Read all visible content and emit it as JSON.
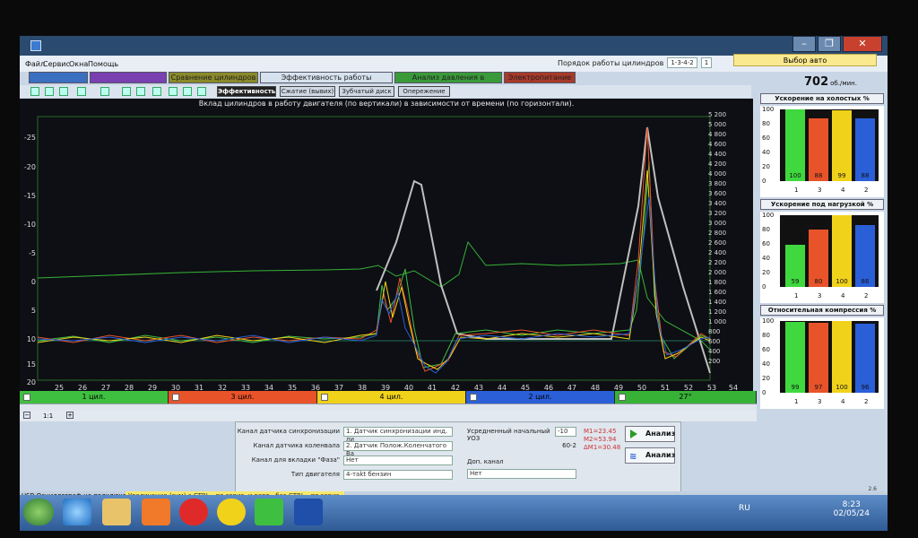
{
  "menu": [
    "Файл",
    "Сервис",
    "Окна",
    "Помощь"
  ],
  "cylinder_order": {
    "label": "Порядок работы цилиндров",
    "value": "1-3-4-2",
    "count": "1"
  },
  "auto_select": "Выбор авто",
  "tabs": [
    {
      "label": "",
      "color": "#3b6fc0"
    },
    {
      "label": "",
      "color": "#7a3fb0"
    },
    {
      "label": "Сравнение цилиндров",
      "color": "#8a8a2a"
    },
    {
      "label": "Эффективность работы цилиндров",
      "color": "#d6e2ee"
    },
    {
      "label": "Анализ давления в цилиндре",
      "color": "#3a9a3a"
    },
    {
      "label": "Электропитание",
      "color": "#a83a2a"
    }
  ],
  "rpm": {
    "value": "702",
    "unit": "об./мин."
  },
  "subtabs": [
    "Эффективность",
    "Сжатие (вывих)",
    "Зубчатый диск",
    "Опережение"
  ],
  "plot_title": "Вклад цилиндров в работу двигателя (по вертикали) в зависимости от времени (по горизонтали).",
  "left_ticks": [
    "-25",
    "-20",
    "-15",
    "-10",
    "-5",
    "0",
    "5",
    "10",
    "15",
    "20"
  ],
  "right_ticks": [
    "5 200",
    "5 000",
    "4 800",
    "4 600",
    "4 400",
    "4 200",
    "4 000",
    "3 800",
    "3 600",
    "3 400",
    "3 200",
    "3 000",
    "2 800",
    "2 600",
    "2 400",
    "2 200",
    "2 000",
    "1 800",
    "1 600",
    "1 400",
    "1 200",
    "1 000",
    "800",
    "600",
    "400",
    "200"
  ],
  "x_ticks": [
    "25",
    "26",
    "27",
    "28",
    "29",
    "30",
    "31",
    "32",
    "33",
    "34",
    "35",
    "36",
    "37",
    "38",
    "39",
    "40",
    "41",
    "42",
    "43",
    "44",
    "45",
    "46",
    "47",
    "48",
    "49",
    "50",
    "51",
    "52",
    "53",
    "54"
  ],
  "channels": [
    {
      "label": "1 цил.",
      "color": "#3fbf3f"
    },
    {
      "label": "3 цил.",
      "color": "#e8532a"
    },
    {
      "label": "4 цил.",
      "color": "#f0d21a"
    },
    {
      "label": "2 цил.",
      "color": "#2a5fd8"
    },
    {
      "label": "27°",
      "color": "#37b237"
    }
  ],
  "zoom": "1:1",
  "panels": [
    {
      "title": "Ускорение на холостых %",
      "values": [
        100,
        88,
        99,
        88
      ],
      "labels": [
        "100",
        "88",
        "99",
        "88"
      ]
    },
    {
      "title": "Ускорение под нагрузкой %",
      "values": [
        59,
        80,
        100,
        86
      ],
      "labels": [
        "59",
        "80",
        "100",
        "86"
      ]
    },
    {
      "title": "Относительная компрессия %",
      "values": [
        99,
        97,
        100,
        96
      ],
      "labels": [
        "99",
        "97",
        "100",
        "96"
      ]
    }
  ],
  "bar_order": [
    "1",
    "3",
    "4",
    "2"
  ],
  "bar_colors": [
    "#3fd83f",
    "#e8532a",
    "#f0d21a",
    "#2a5fd8"
  ],
  "bar_axis": [
    "100",
    "80",
    "60",
    "40",
    "20",
    "0"
  ],
  "form": {
    "sync_label": "Канал датчика синхронизации",
    "sync_value": "1. Датчик синхронизации инд. ли",
    "crank_label": "Канал датчика коленвала",
    "crank_value": "2. Датчик Полож.Коленчатого Ва",
    "phase_label": "Канал для вкладки \"Фаза\"",
    "phase_value": "Нет",
    "engine_label": "Тип двигателя",
    "engine_value": "4-тakt бензин",
    "uoz_label": "Усредненный начальный УОЗ",
    "uoz_value": "-10",
    "disc": "60-2",
    "extra_label": "Доп. канал",
    "extra_value": "Нет",
    "markers": [
      "M1=23.45",
      "M2=53.94",
      "ΔM1=30.48"
    ],
    "analyze_1": "Анализ",
    "analyze_2": "Анализ"
  },
  "version": "2.6",
  "status": "USB Осциллограф не подключен",
  "hint": "Увеличение (зум) с CTRL - по гориз. и верт., без CTRL - по гориз.",
  "tray": {
    "lang": "RU",
    "time": "8:23",
    "date": "02/05/24"
  }
}
